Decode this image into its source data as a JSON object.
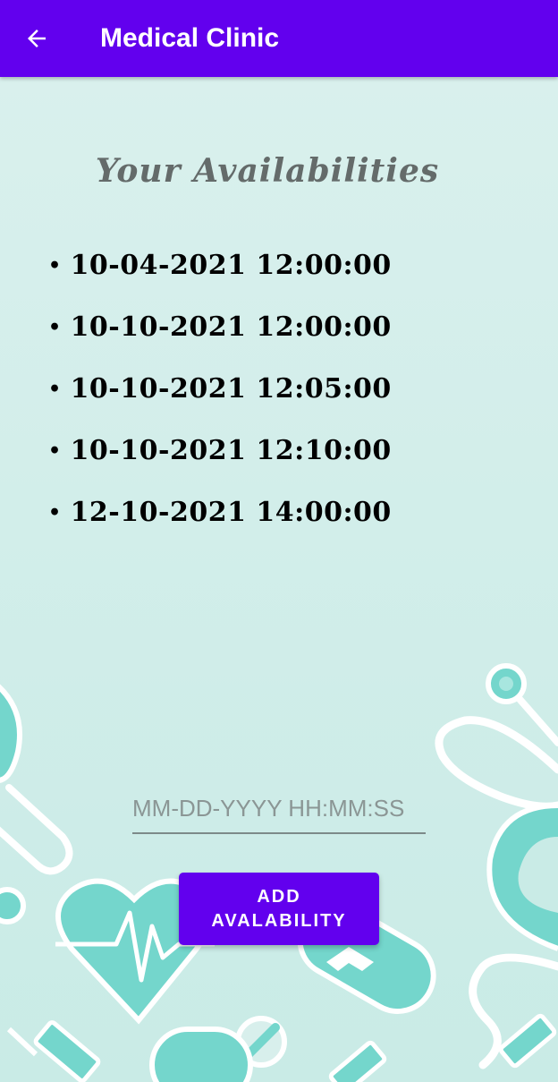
{
  "appbar": {
    "title": "Medical Clinic",
    "back_icon": "arrow-left-icon",
    "color": "#6200ee"
  },
  "main": {
    "heading": "Your Availabilities",
    "availabilities": [
      "10-04-2021 12:00:00",
      "10-10-2021 12:00:00",
      "10-10-2021 12:05:00",
      "10-10-2021 12:10:00",
      "12-10-2021 14:00:00"
    ],
    "datetime_input": {
      "value": "",
      "placeholder": "MM-DD-YYYY HH:MM:SS"
    },
    "add_button_label": "ADD AVALABILITY"
  },
  "background": {
    "color": "#d8efec",
    "accent": "#74d6cc",
    "decorations": [
      "stethoscope-icon",
      "heart-pulse-icon",
      "pill-icon",
      "syringe-icon"
    ]
  }
}
